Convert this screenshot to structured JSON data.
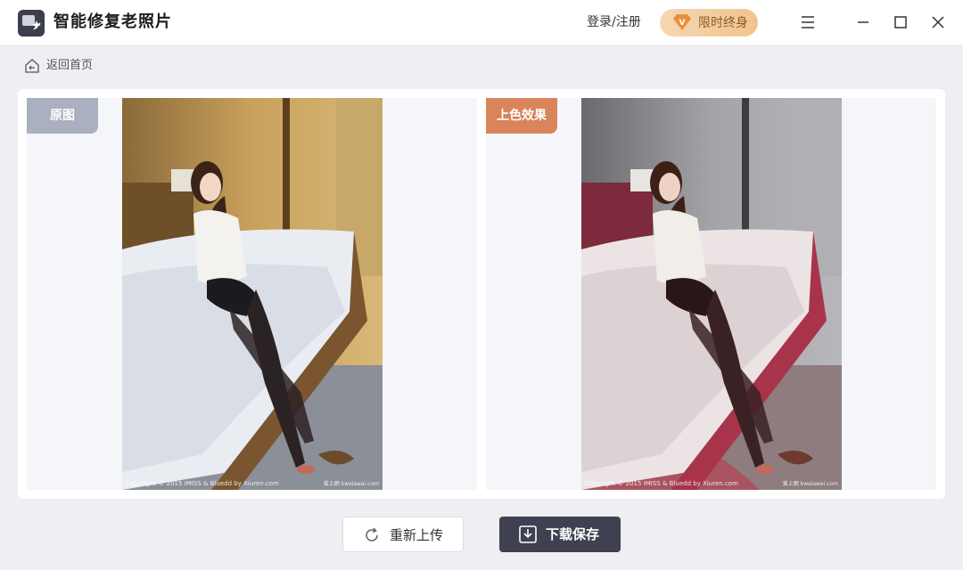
{
  "app": {
    "title": "智能修复老照片",
    "login_label": "登录/注册",
    "vip_label": "限时终身",
    "vip_badge_letter": "V"
  },
  "window_controls": {
    "menu_icon": "hamburger-menu-icon",
    "minimize_icon": "minimize-icon",
    "maximize_icon": "maximize-icon",
    "close_icon": "close-icon"
  },
  "nav": {
    "back_label": "返回首页",
    "back_icon": "home-back-icon"
  },
  "compare": {
    "original_tag": "原图",
    "result_tag": "上色效果",
    "original_caption": "Copyright © 2015 IMISS & Bluedd by Xiuren.com",
    "result_caption": "Copyright © 2015 IMISS & Bluedd by Xiuren.com",
    "original_caption_right": "爱上網 kwaiawai.com",
    "result_caption_right": "爱上網 kwaiawai.com"
  },
  "actions": {
    "reupload_label": "重新上传",
    "download_label": "下载保存",
    "reupload_icon": "refresh-icon",
    "download_icon": "download-icon"
  },
  "colors": {
    "tag_original": "#aab0bf",
    "tag_result": "#d9845a",
    "download_button": "#3f4150",
    "vip_gradient_start": "#f6d7b2",
    "vip_gradient_end": "#f0c48f"
  }
}
